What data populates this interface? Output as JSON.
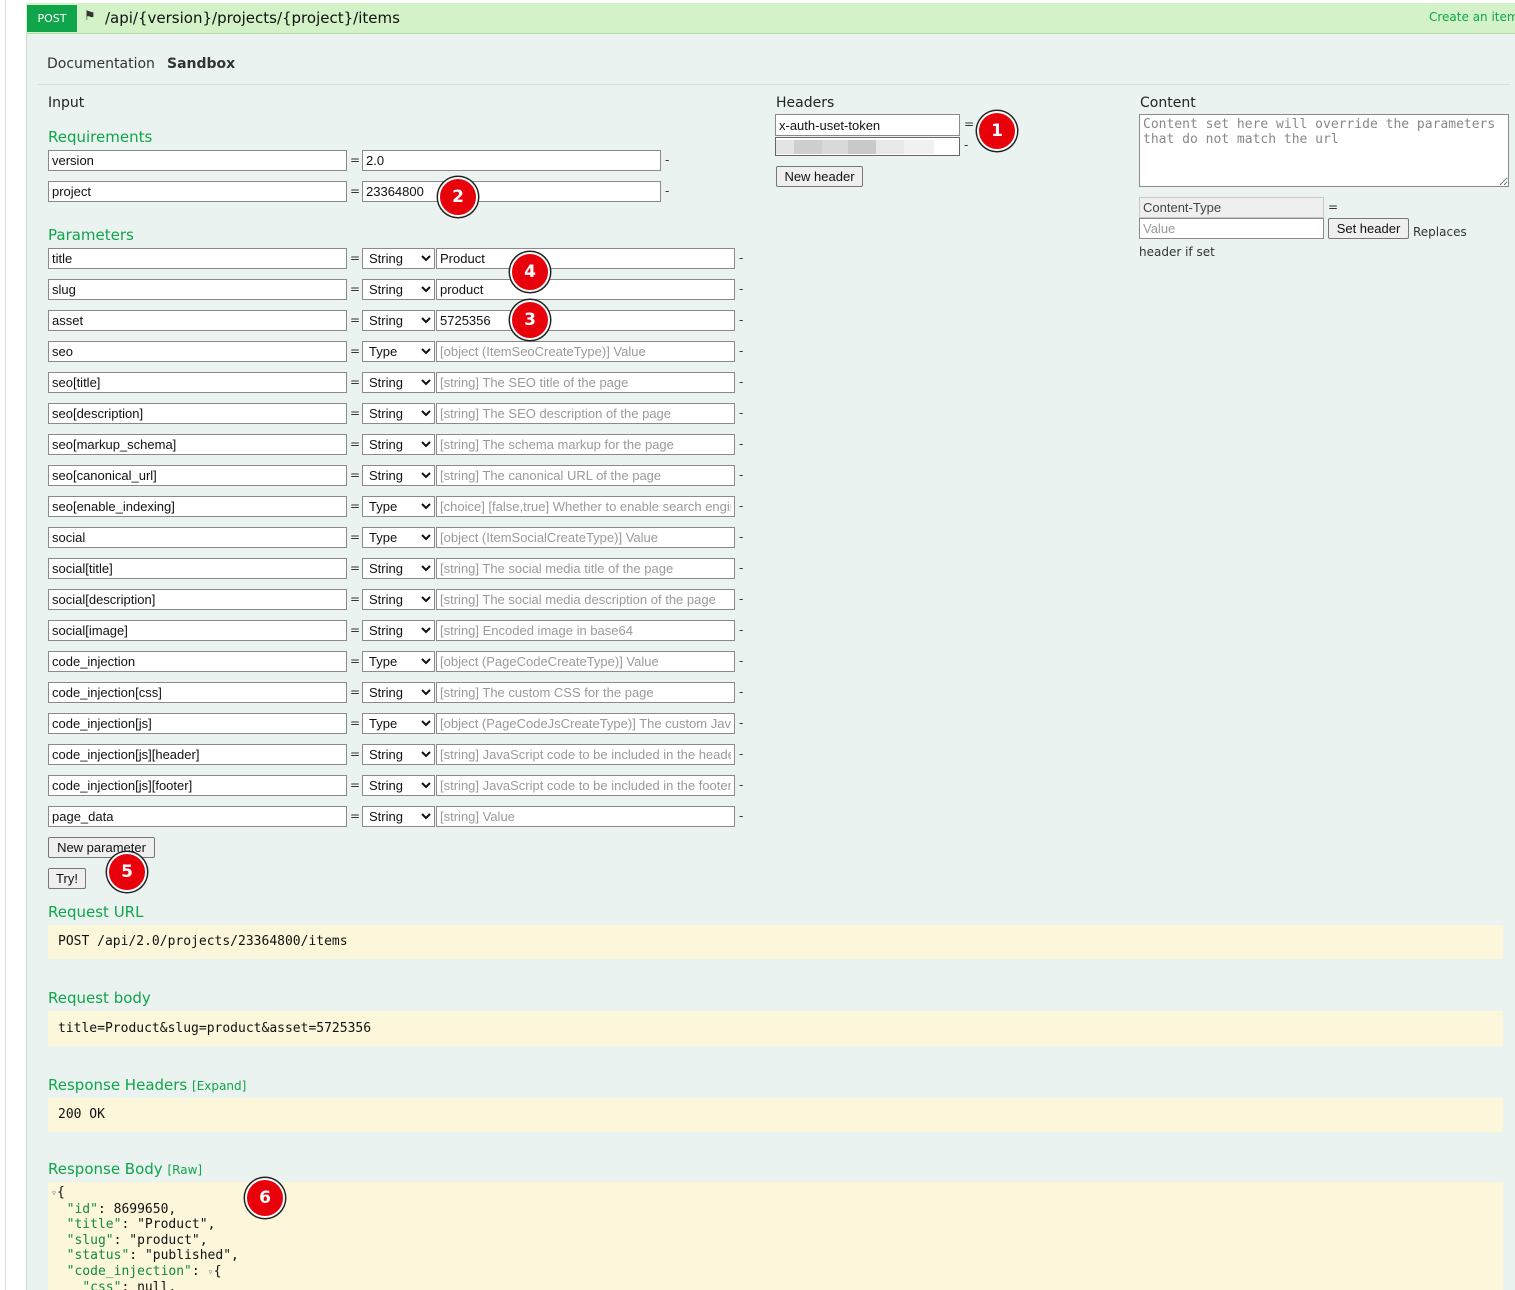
{
  "endpoint": {
    "method": "POST",
    "path": "/api/{version}/projects/{project}/items",
    "description": "Create an item"
  },
  "tabs": [
    "Documentation",
    "Sandbox"
  ],
  "active_tab": "Sandbox",
  "input_label": "Input",
  "requirements_label": "Requirements",
  "requirements": [
    {
      "name": "version",
      "value": "2.0"
    },
    {
      "name": "project",
      "value": "23364800"
    }
  ],
  "parameters_label": "Parameters",
  "type_options": [
    "String",
    "Type"
  ],
  "parameters": [
    {
      "name": "title",
      "type": "String",
      "value": "Product",
      "placeholder": ""
    },
    {
      "name": "slug",
      "type": "String",
      "value": "product",
      "placeholder": ""
    },
    {
      "name": "asset",
      "type": "String",
      "value": "5725356",
      "placeholder": ""
    },
    {
      "name": "seo",
      "type": "Type",
      "value": "",
      "placeholder": "[object (ItemSeoCreateType)] Value"
    },
    {
      "name": "seo[title]",
      "type": "String",
      "value": "",
      "placeholder": "[string] The SEO title of the page"
    },
    {
      "name": "seo[description]",
      "type": "String",
      "value": "",
      "placeholder": "[string] The SEO description of the page"
    },
    {
      "name": "seo[markup_schema]",
      "type": "String",
      "value": "",
      "placeholder": "[string] The schema markup for the page"
    },
    {
      "name": "seo[canonical_url]",
      "type": "String",
      "value": "",
      "placeholder": "[string] The canonical URL of the page"
    },
    {
      "name": "seo[enable_indexing]",
      "type": "Type",
      "value": "",
      "placeholder": "[choice] [false,true] Whether to enable search engine indexing"
    },
    {
      "name": "social",
      "type": "Type",
      "value": "",
      "placeholder": "[object (ItemSocialCreateType)] Value"
    },
    {
      "name": "social[title]",
      "type": "String",
      "value": "",
      "placeholder": "[string] The social media title of the page"
    },
    {
      "name": "social[description]",
      "type": "String",
      "value": "",
      "placeholder": "[string] The social media description of the page"
    },
    {
      "name": "social[image]",
      "type": "String",
      "value": "",
      "placeholder": "[string] Encoded image in base64"
    },
    {
      "name": "code_injection",
      "type": "Type",
      "value": "",
      "placeholder": "[object (PageCodeCreateType)] Value"
    },
    {
      "name": "code_injection[css]",
      "type": "String",
      "value": "",
      "placeholder": "[string] The custom CSS for the page"
    },
    {
      "name": "code_injection[js]",
      "type": "Type",
      "value": "",
      "placeholder": "[object (PageCodeJsCreateType)] The custom JavaScript"
    },
    {
      "name": "code_injection[js][header]",
      "type": "String",
      "value": "",
      "placeholder": "[string] JavaScript code to be included in the header"
    },
    {
      "name": "code_injection[js][footer]",
      "type": "String",
      "value": "",
      "placeholder": "[string] JavaScript code to be included in the footer"
    },
    {
      "name": "page_data",
      "type": "String",
      "value": "",
      "placeholder": "[string] Value"
    }
  ],
  "new_parameter_label": "New parameter",
  "try_label": "Try!",
  "headers_label": "Headers",
  "header": {
    "name": "x-auth-uset-token"
  },
  "new_header_label": "New header",
  "content_label": "Content",
  "content_placeholder": "Content set here will override the parameters that do not match the url",
  "content_type": {
    "name": "Content-Type",
    "value_placeholder": "Value",
    "set_label": "Set header",
    "note": "Replaces header if set"
  },
  "request_url_label": "Request URL",
  "request_url": "POST /api/2.0/projects/23364800/items",
  "request_body_label": "Request body",
  "request_body": "title=Product&slug=product&asset=5725356",
  "response_headers_label": "Response Headers",
  "expand_label": "[Expand]",
  "response_status": "200 OK",
  "response_body_label": "Response Body",
  "raw_label": "[Raw]",
  "response_json": {
    "id": "8699650",
    "title": "\"Product\"",
    "slug": "\"product\"",
    "status": "\"published\"",
    "code_injection_key": "\"code_injection\"",
    "css": "null,"
  },
  "markers": [
    "1",
    "2",
    "3",
    "4",
    "5",
    "6"
  ],
  "colors": {
    "accent": "#10a54a",
    "panel": "#ebf3f0",
    "topbar": "#d4f2c7",
    "code_bg": "#fcf6db",
    "marker": "#e8000b"
  }
}
